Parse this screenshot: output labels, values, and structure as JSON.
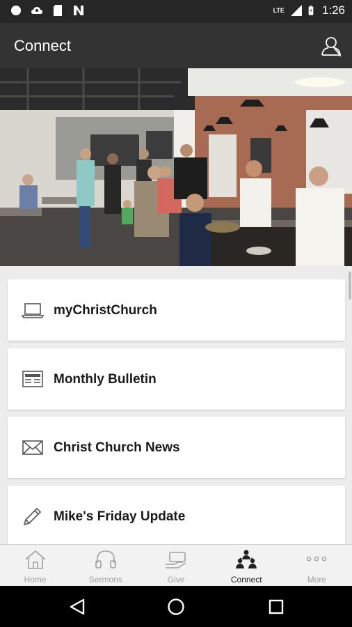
{
  "status_bar": {
    "time": "1:26",
    "network_label": "LTE",
    "icons": [
      "notification-dot-icon",
      "cloud-icon",
      "sd-card-icon",
      "n-icon",
      "signal-icon",
      "battery-icon"
    ]
  },
  "app_bar": {
    "title": "Connect",
    "profile_icon": "person-icon"
  },
  "hero": {
    "image_kind": "photo",
    "description_icon": "church-cafe-photo"
  },
  "list": {
    "items": [
      {
        "label": "myChristChurch",
        "icon": "laptop-icon"
      },
      {
        "label": "Monthly Bulletin",
        "icon": "newspaper-icon"
      },
      {
        "label": "Christ Church News",
        "icon": "envelope-icon"
      },
      {
        "label": "Mike's Friday Update",
        "icon": "pencil-icon"
      }
    ]
  },
  "tabs": [
    {
      "label": "Home",
      "icon": "home-icon",
      "active": false
    },
    {
      "label": "Sermons",
      "icon": "headphones-icon",
      "active": false
    },
    {
      "label": "Give",
      "icon": "giving-hand-icon",
      "active": false
    },
    {
      "label": "Connect",
      "icon": "people-icon",
      "active": true
    },
    {
      "label": "More",
      "icon": "more-dots-icon",
      "active": false
    }
  ],
  "colors": {
    "status_bar": "#262626",
    "app_bar": "#333333",
    "background": "#ececec",
    "tab_active": "#222222",
    "tab_inactive": "#a0a0a0"
  }
}
